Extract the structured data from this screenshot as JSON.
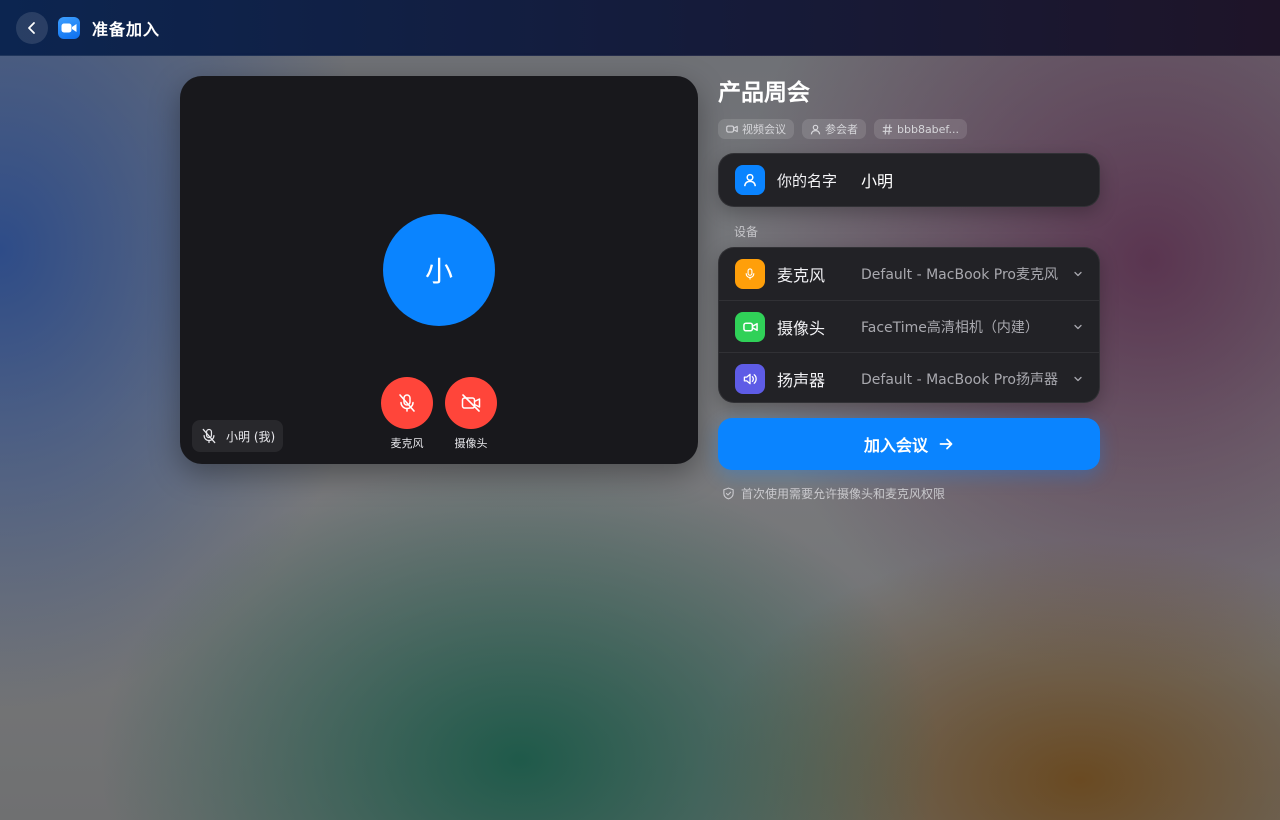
{
  "topbar": {
    "title": "准备加入",
    "back_icon": "chevron-left-icon",
    "logo_icon": "video-camera-icon"
  },
  "preview": {
    "avatar_initial": "小",
    "name_tag": "小明 (我)",
    "mic_label": "麦克风",
    "camera_label": "摄像头",
    "mic_state": "muted",
    "camera_state": "off"
  },
  "meeting": {
    "title": "产品周会",
    "chips": {
      "type": "视频会议",
      "participants": "参会者",
      "id": "bbb8abef..."
    }
  },
  "name_field": {
    "label": "你的名字",
    "value": "小明"
  },
  "devices": {
    "section_label": "设备",
    "microphone": {
      "label": "麦克风",
      "value": "Default - MacBook Pro麦克风",
      "color": "#ff9f0a"
    },
    "camera": {
      "label": "摄像头",
      "value": "FaceTime高清相机（内建）",
      "color": "#30d158"
    },
    "speaker": {
      "label": "扬声器",
      "value": "Default - MacBook Pro扬声器",
      "color": "#5e5ce6"
    }
  },
  "join": {
    "label": "加入会议"
  },
  "hint": {
    "text": "首次使用需要允许摄像头和麦克风权限"
  },
  "colors": {
    "accent": "#0a84ff",
    "danger": "#ff453a",
    "card": "#222226",
    "preview_bg": "#18181c"
  }
}
